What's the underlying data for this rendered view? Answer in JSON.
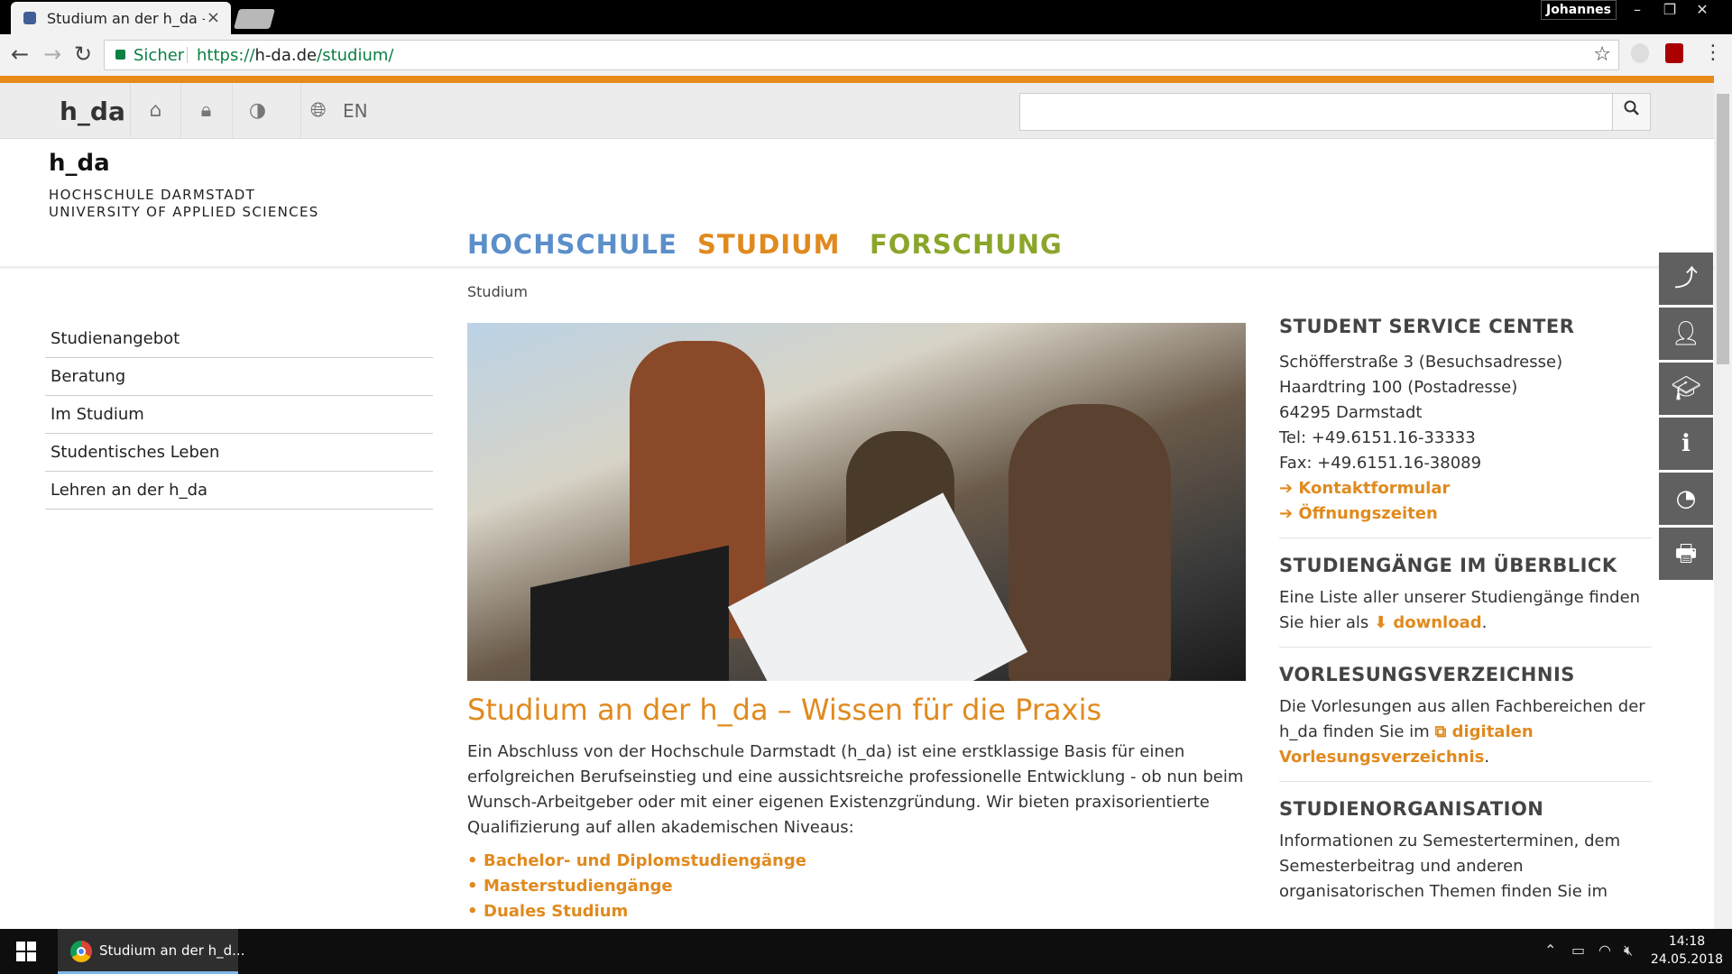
{
  "browser": {
    "tab_title": "Studium an der h_da – W",
    "tab_close": "×",
    "profile": "Johannes",
    "security_label": "Sicher",
    "url_scheme": "https://",
    "url_domain": "h-da.de",
    "url_path": "/studium/"
  },
  "topbar": {
    "logo": "h_da",
    "lang": "EN",
    "search_placeholder": ""
  },
  "header": {
    "logo": "h_da",
    "subtitle_line1": "HOCHSCHULE DARMSTADT",
    "subtitle_line2": "UNIVERSITY OF APPLIED SCIENCES",
    "nav": [
      {
        "label": "HOCHSCHULE",
        "color": "#5b8fc9"
      },
      {
        "label": "STUDIUM",
        "color": "#e08a1e"
      },
      {
        "label": "FORSCHUNG",
        "color": "#8aa62a"
      }
    ]
  },
  "breadcrumb": "Studium",
  "leftnav": [
    "Studienangebot",
    "Beratung",
    "Im Studium",
    "Studentisches Leben",
    "Lehren an der h_da"
  ],
  "main": {
    "headline": "Studium an der h_da – Wissen für die Praxis",
    "intro": "Ein Abschluss von der Hochschule Darmstadt (h_da) ist eine erstklassige Basis für einen erfolgreichen Berufseinstieg und eine aussichtsreiche professionelle Entwicklung - ob nun beim Wunsch-Arbeitgeber oder mit einer eigenen Existenzgründung.  Wir bieten praxisorientierte Qualifizierung auf allen akademischen Niveaus:",
    "links": [
      "Bachelor- und Diplomstudiengänge",
      "Masterstudiengänge",
      "Duales Studium"
    ]
  },
  "sidebar": {
    "ssc_title": "STUDENT SERVICE CENTER",
    "ssc_lines": [
      "Schöfferstraße 3 (Besuchsadresse)",
      "Haardtring 100 (Postadresse)",
      "64295 Darmstadt",
      "Tel: +49.6151.16-33333",
      "Fax: +49.6151.16-38089"
    ],
    "ssc_links": [
      "Kontaktformular",
      "Öffnungszeiten"
    ],
    "sg_title": "STUDIENGÄNGE IM ÜBERBLICK",
    "sg_text": "Eine Liste aller unserer Studiengänge finden Sie hier als",
    "sg_link": "download",
    "vv_title": "VORLESUNGSVERZEICHNIS",
    "vv_text": "Die Vorlesungen aus allen Fachbereichen der h_da finden Sie im",
    "vv_link": "digitalen Vorlesungsverzeichnis",
    "so_title": "STUDIENORGANISATION",
    "so_text": "Informationen zu Semesterterminen, dem Semesterbeitrag und anderen organisatorischen Themen finden Sie im"
  },
  "sidetools": [
    "share-icon",
    "user-icon",
    "graduation-cap-icon",
    "info-icon",
    "rss-icon",
    "print-icon"
  ],
  "taskbar": {
    "app_label": "Studium an der h_d...",
    "time": "14:18",
    "date": "24.05.2018"
  },
  "colors": {
    "accent_orange": "#e08a1e",
    "nav_blue": "#5b8fc9",
    "nav_green": "#8aa62a"
  }
}
